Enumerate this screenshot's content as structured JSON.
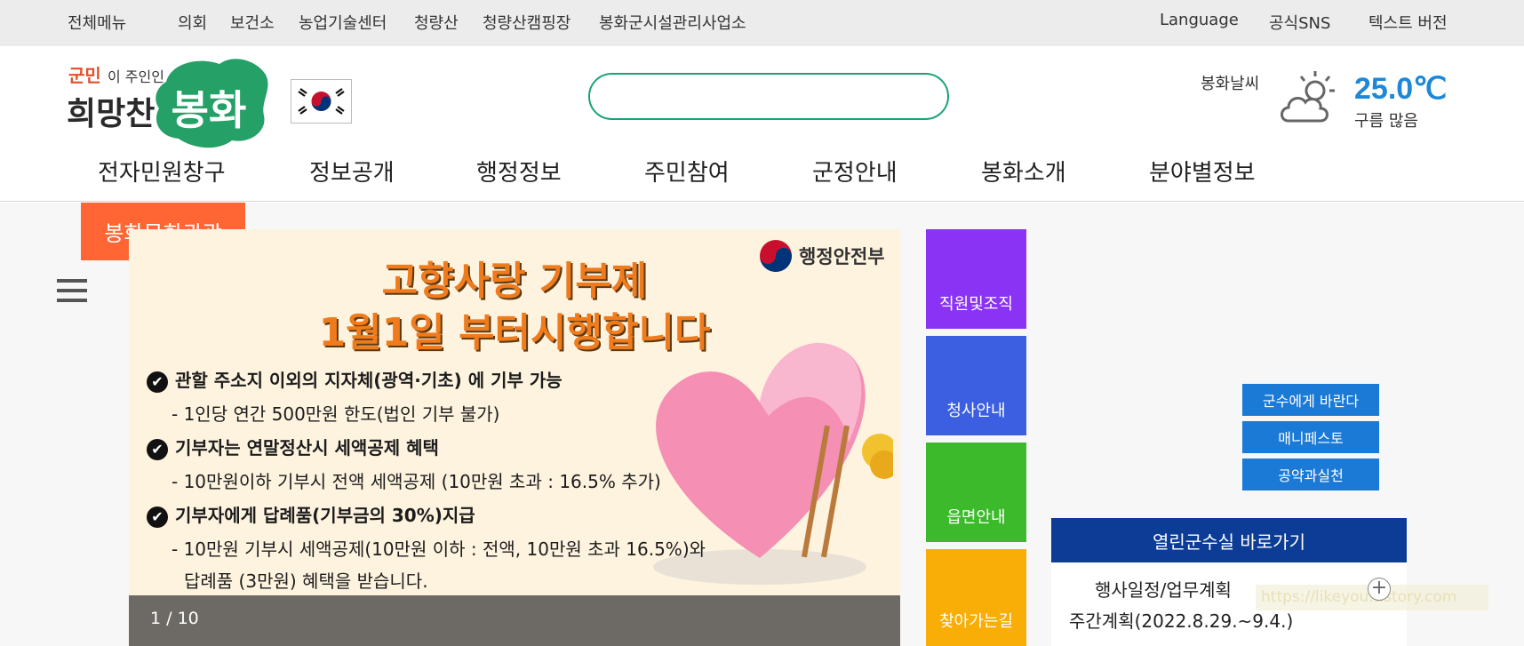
{
  "topbar": {
    "menu_all": "전체메뉴",
    "links": [
      "의회",
      "보건소",
      "농업기술센터",
      "청량산",
      "청량산캠핑장",
      "봉화군시설관리사업소"
    ],
    "language": "Language",
    "sns": "공식SNS",
    "text_version": "텍스트 버전"
  },
  "header": {
    "logo_tagline": "군민이 주인인",
    "logo_main": "희망찬 봉화",
    "search": {
      "value": "",
      "placeholder": ""
    },
    "weather": {
      "label": "봉화날씨",
      "temperature": "25.0℃",
      "condition": "구름 많음",
      "icon": "cloudy-sun-icon"
    }
  },
  "gnb": [
    "전자민원창구",
    "정보공개",
    "행정정보",
    "주민참여",
    "군정안내",
    "봉화소개",
    "분야별정보"
  ],
  "main": {
    "tourism_tab": "봉화문화관광",
    "banner": {
      "ministry": "행정안전부",
      "title_line1": "고향사랑 기부제",
      "title_line2": "1월1일 부터시행합니다",
      "lines": [
        {
          "text": "관할 주소지 이외의 지자체(광역·기초) 에 기부 가능",
          "bold": true
        },
        {
          "text": "- 1인당 연간 500만원 한도(법인 기부 불가)",
          "bold": false
        },
        {
          "text": "기부자는 연말정산시 세액공제 혜택",
          "bold": true
        },
        {
          "text": "- 10만원이하 기부시 전액 세액공제 (10만원 초과 : 16.5% 추가)",
          "bold": false
        },
        {
          "text": "기부자에게 답례품(기부금의 30%)지급",
          "bold": true
        },
        {
          "text": "- 10만원 기부시  세액공제(10만원 이하 : 전액, 10만원 초과 16.5%)와",
          "bold": false
        },
        {
          "text": "답례품 (3만원) 혜택을 받습니다.",
          "bold": false
        }
      ],
      "counter": "1 / 10"
    },
    "tiles": [
      {
        "label": "직원및조직",
        "color": "#8a33f5"
      },
      {
        "label": "청사안내",
        "color": "#3b5fe0"
      },
      {
        "label": "읍면안내",
        "color": "#3cba2c"
      },
      {
        "label": "찾아가는길",
        "color": "#f9ad07"
      }
    ],
    "right_buttons": [
      "군수에게 바란다",
      "매니페스토",
      "공약과실천"
    ],
    "open_room": {
      "title": "열린군수실 바로가기",
      "schedule_label": "행사일정/업무계획",
      "weekly_plan": "주간계획(2022.8.29.~9.4.)",
      "watermark": "https://likeyou.tistory.com"
    }
  }
}
